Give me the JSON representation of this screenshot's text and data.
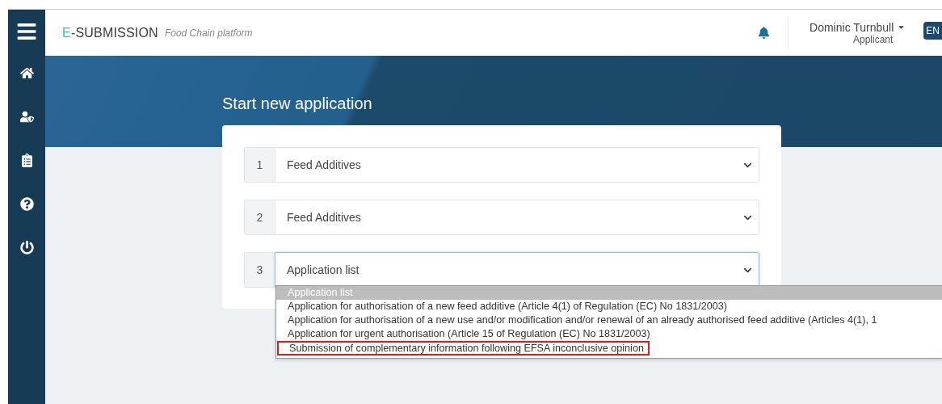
{
  "header": {
    "brand_initial": "E",
    "brand_rest": "-SUBMISSION",
    "subtitle": "Food Chain platform",
    "user_name": "Dominic Turnbull",
    "user_role": "Applicant",
    "language": "EN"
  },
  "page_title": "Start new application",
  "steps": [
    {
      "number": "1",
      "value": "Feed Additives",
      "focused": false
    },
    {
      "number": "2",
      "value": "Feed Additives",
      "focused": false
    },
    {
      "number": "3",
      "value": "Application list",
      "focused": true
    }
  ],
  "dropdown": {
    "options": [
      {
        "label": "Application list",
        "selected": true,
        "marked": false
      },
      {
        "label": "Application for authorisation of a new feed additive (Article 4(1) of Regulation (EC) No 1831/2003)",
        "selected": false,
        "marked": false
      },
      {
        "label": "Application for authorisation of a new use and/or modification and/or renewal of an already authorised feed additive (Articles 4(1), 1",
        "selected": false,
        "marked": false
      },
      {
        "label": "Application for urgent authorisation (Article 15 of Regulation (EC) No 1831/2003)",
        "selected": false,
        "marked": false
      },
      {
        "label": "Submission of complementary information following EFSA inconclusive opinion",
        "selected": false,
        "marked": true
      }
    ]
  }
}
